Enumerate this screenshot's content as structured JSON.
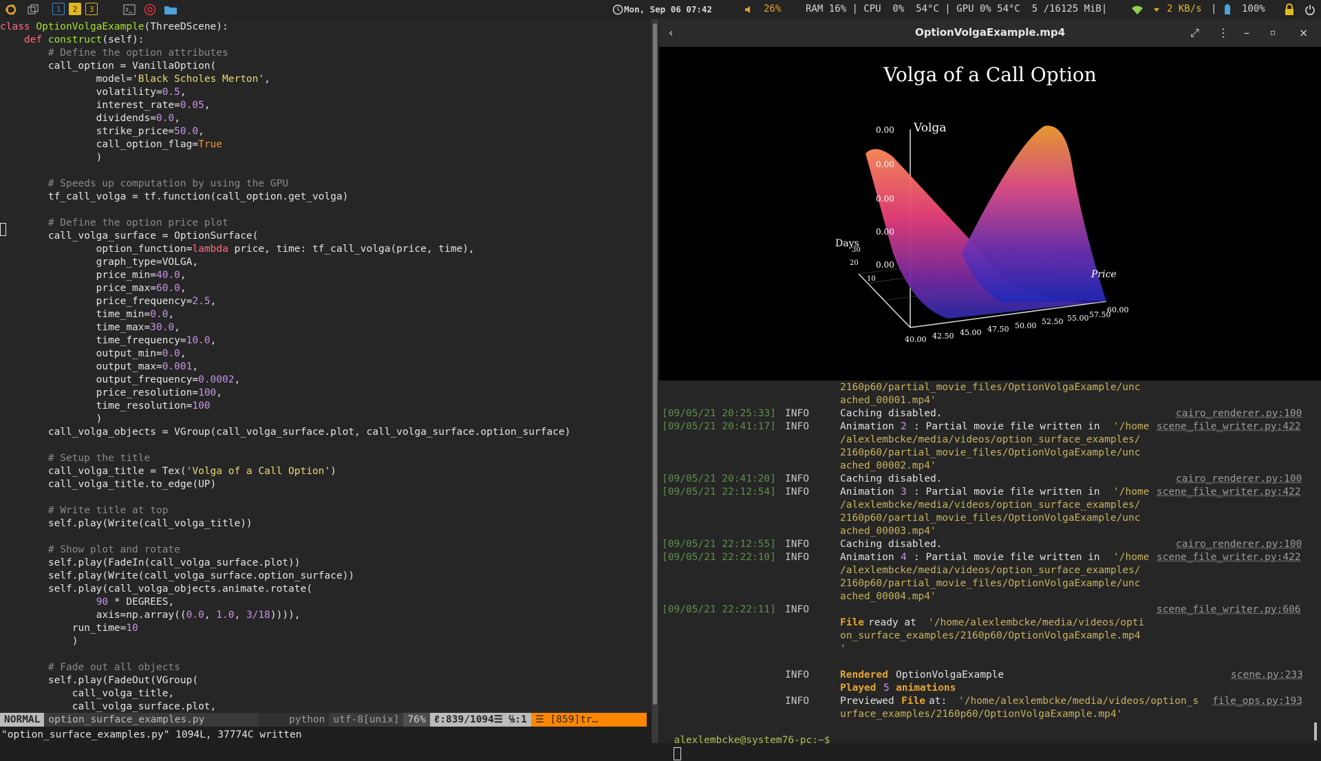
{
  "topbar": {
    "workspaces": [
      "1",
      "2",
      "3"
    ],
    "datetime": "Mon, Sep 06 07:42",
    "volume": "26%",
    "stats": "RAM 16% | CPU  0%  54°C | GPU 0% 54°C  5 /16125 MiB|",
    "net": "2 KB/s",
    "battery": "100%"
  },
  "editor": {
    "lines": [
      [
        [
          "kw",
          "class "
        ],
        [
          "cls",
          "OptionVolgaExample"
        ],
        [
          "fn",
          "(ThreeDScene):"
        ]
      ],
      [
        [
          "fn",
          "    "
        ],
        [
          "kw",
          "def "
        ],
        [
          "cls",
          "construct"
        ],
        [
          "fn",
          "(self):"
        ]
      ],
      [
        [
          "cmt",
          "        # Define the option attributes"
        ]
      ],
      [
        [
          "fn",
          "        call_option = VanillaOption("
        ]
      ],
      [
        [
          "fn",
          "                model="
        ],
        [
          "str",
          "'Black Scholes Merton'"
        ],
        [
          "fn",
          ","
        ]
      ],
      [
        [
          "fn",
          "                volatility="
        ],
        [
          "num",
          "0.5"
        ],
        [
          "fn",
          ","
        ]
      ],
      [
        [
          "fn",
          "                interest_rate="
        ],
        [
          "num",
          "0.05"
        ],
        [
          "fn",
          ","
        ]
      ],
      [
        [
          "fn",
          "                dividends="
        ],
        [
          "num",
          "0.0"
        ],
        [
          "fn",
          ","
        ]
      ],
      [
        [
          "fn",
          "                strike_price="
        ],
        [
          "num",
          "50.0"
        ],
        [
          "fn",
          ","
        ]
      ],
      [
        [
          "fn",
          "                call_option_flag="
        ],
        [
          "bool",
          "True"
        ]
      ],
      [
        [
          "fn",
          "                )"
        ]
      ],
      [
        [
          "fn",
          ""
        ]
      ],
      [
        [
          "cmt",
          "        # Speeds up computation by using the GPU"
        ]
      ],
      [
        [
          "fn",
          "        tf_call_volga = tf.function(call_option.get_volga)"
        ]
      ],
      [
        [
          "fn",
          ""
        ]
      ],
      [
        [
          "cmt",
          "        # Define the option price plot"
        ]
      ],
      [
        [
          "fn",
          "        call_volga_surface = OptionSurface("
        ]
      ],
      [
        [
          "fn",
          "                option_function="
        ],
        [
          "kw",
          "lambda "
        ],
        [
          "fn",
          "price, time: tf_call_volga(price, time),"
        ]
      ],
      [
        [
          "fn",
          "                graph_type=VOLGA,"
        ]
      ],
      [
        [
          "fn",
          "                price_min="
        ],
        [
          "num",
          "40.0"
        ],
        [
          "fn",
          ","
        ]
      ],
      [
        [
          "fn",
          "                price_max="
        ],
        [
          "num",
          "60.0"
        ],
        [
          "fn",
          ","
        ]
      ],
      [
        [
          "fn",
          "                price_frequency="
        ],
        [
          "num",
          "2.5"
        ],
        [
          "fn",
          ","
        ]
      ],
      [
        [
          "fn",
          "                time_min="
        ],
        [
          "num",
          "0.0"
        ],
        [
          "fn",
          ","
        ]
      ],
      [
        [
          "fn",
          "                time_max="
        ],
        [
          "num",
          "30.0"
        ],
        [
          "fn",
          ","
        ]
      ],
      [
        [
          "fn",
          "                time_frequency="
        ],
        [
          "num",
          "10.0"
        ],
        [
          "fn",
          ","
        ]
      ],
      [
        [
          "fn",
          "                output_min="
        ],
        [
          "num",
          "0.0"
        ],
        [
          "fn",
          ","
        ]
      ],
      [
        [
          "fn",
          "                output_max="
        ],
        [
          "num",
          "0.001"
        ],
        [
          "fn",
          ","
        ]
      ],
      [
        [
          "fn",
          "                output_frequency="
        ],
        [
          "num",
          "0.0002"
        ],
        [
          "fn",
          ","
        ]
      ],
      [
        [
          "fn",
          "                price_resolution="
        ],
        [
          "num",
          "100"
        ],
        [
          "fn",
          ","
        ]
      ],
      [
        [
          "fn",
          "                time_resolution="
        ],
        [
          "num",
          "100"
        ]
      ],
      [
        [
          "fn",
          "                )"
        ]
      ],
      [
        [
          "fn",
          "        call_volga_objects = VGroup(call_volga_surface.plot, call_volga_surface.option_surface)"
        ]
      ],
      [
        [
          "fn",
          ""
        ]
      ],
      [
        [
          "cmt",
          "        # Setup the title"
        ]
      ],
      [
        [
          "fn",
          "        call_volga_title = Tex("
        ],
        [
          "str",
          "'Volga of a Call Option'"
        ],
        [
          "fn",
          ")"
        ]
      ],
      [
        [
          "fn",
          "        call_volga_title.to_edge(UP)"
        ]
      ],
      [
        [
          "fn",
          ""
        ]
      ],
      [
        [
          "cmt",
          "        # Write title at top"
        ]
      ],
      [
        [
          "fn",
          "        self.play(Write(call_volga_title))"
        ]
      ],
      [
        [
          "fn",
          ""
        ]
      ],
      [
        [
          "cmt",
          "        # Show plot and rotate"
        ]
      ],
      [
        [
          "fn",
          "        self.play(FadeIn(call_volga_surface.plot))"
        ]
      ],
      [
        [
          "fn",
          "        self.play(Write(call_volga_surface.option_surface))"
        ]
      ],
      [
        [
          "fn",
          "        self.play(call_volga_objects.animate.rotate("
        ]
      ],
      [
        [
          "fn",
          "                "
        ],
        [
          "num",
          "90"
        ],
        [
          "fn",
          " * DEGREES,"
        ]
      ],
      [
        [
          "fn",
          "                axis=np.array(("
        ],
        [
          "num",
          "0.0"
        ],
        [
          "fn",
          ", "
        ],
        [
          "num",
          "1.0"
        ],
        [
          "fn",
          ", "
        ],
        [
          "num",
          "3/18"
        ],
        [
          "fn",
          ")))),"
        ]
      ],
      [
        [
          "fn",
          "            run_time="
        ],
        [
          "num",
          "10"
        ]
      ],
      [
        [
          "fn",
          "            )"
        ]
      ],
      [
        [
          "fn",
          ""
        ]
      ],
      [
        [
          "cmt",
          "        # Fade out all objects"
        ]
      ],
      [
        [
          "fn",
          "        self.play(FadeOut(VGroup("
        ]
      ],
      [
        [
          "fn",
          "            call_volga_title,"
        ]
      ],
      [
        [
          "fn",
          "            call_volga_surface.plot,"
        ]
      ]
    ],
    "status": {
      "mode": "NORMAL",
      "file": "option_surface_examples.py",
      "filetype": "python",
      "encoding": "utf-8[unix]",
      "percent": "76%",
      "position": "ℓ:839/1094☰ ℅:1",
      "warning": "☰ [859]tr…"
    },
    "cmdline": "\"option_surface_examples.py\" 1094L, 37774C written"
  },
  "video": {
    "title": "OptionVolgaExample.mp4",
    "plot_title": "Volga of a Call Option",
    "zlabel": "Volga",
    "xlabel": "Price",
    "ylabel": "Days",
    "z_ticks": [
      "0.00",
      "0.00",
      "0.00",
      "0.00",
      "0.00"
    ],
    "x_ticks": [
      "40.00",
      "42.50",
      "45.00",
      "47.50",
      "50.00",
      "52.50",
      "55.00",
      "57.50",
      "60.00"
    ],
    "y_ticks": [
      "10",
      "20",
      "30"
    ]
  },
  "terminal": {
    "lines": [
      {
        "y": 564,
        "cols": [
          {
            "x": 1221,
            "cls": "path",
            "t": "2160p60/partial_movie_files/OptionVolgaExample/unc"
          }
        ]
      },
      {
        "y": 583,
        "cols": [
          {
            "x": 1221,
            "cls": "path",
            "t": "ached_00001.mp4'"
          }
        ]
      },
      {
        "y": 602,
        "cols": [
          {
            "x": 962,
            "cls": "ts",
            "t": "[09/05/21 20:25:33]"
          },
          {
            "x": 1141,
            "cls": "lvl",
            "t": "INFO"
          },
          {
            "x": 1221,
            "cls": "msg",
            "t": "Caching disabled."
          },
          {
            "x": 1709,
            "cls": "src",
            "t": "cairo_renderer.py:100"
          }
        ]
      },
      {
        "y": 621,
        "cols": [
          {
            "x": 962,
            "cls": "ts",
            "t": "[09/05/21 20:41:17]"
          },
          {
            "x": 1141,
            "cls": "lvl",
            "t": "INFO"
          },
          {
            "x": 1221,
            "cls": "msg",
            "t": "Animation "
          },
          {
            "x": 1309,
            "cls": "num",
            "t": "2"
          },
          {
            "x": 1328,
            "cls": "msg",
            "t": ": Partial movie file written in "
          },
          {
            "x": 1618,
            "cls": "path",
            "t": "'/home"
          },
          {
            "x": 1681,
            "cls": "src",
            "t": "scene_file_writer.py:422"
          }
        ]
      },
      {
        "y": 640,
        "cols": [
          {
            "x": 1221,
            "cls": "path",
            "t": "/alexlembcke/media/videos/option_surface_examples/"
          }
        ]
      },
      {
        "y": 659,
        "cols": [
          {
            "x": 1221,
            "cls": "path",
            "t": "2160p60/partial_movie_files/OptionVolgaExample/unc"
          }
        ]
      },
      {
        "y": 678,
        "cols": [
          {
            "x": 1221,
            "cls": "path",
            "t": "ached_00002.mp4'"
          }
        ]
      },
      {
        "y": 697,
        "cols": [
          {
            "x": 962,
            "cls": "ts",
            "t": "[09/05/21 20:41:20]"
          },
          {
            "x": 1141,
            "cls": "lvl",
            "t": "INFO"
          },
          {
            "x": 1221,
            "cls": "msg",
            "t": "Caching disabled."
          },
          {
            "x": 1709,
            "cls": "src",
            "t": "cairo_renderer.py:100"
          }
        ]
      },
      {
        "y": 716,
        "cols": [
          {
            "x": 962,
            "cls": "ts",
            "t": "[09/05/21 22:12:54]"
          },
          {
            "x": 1141,
            "cls": "lvl",
            "t": "INFO"
          },
          {
            "x": 1221,
            "cls": "msg",
            "t": "Animation "
          },
          {
            "x": 1309,
            "cls": "num",
            "t": "3"
          },
          {
            "x": 1328,
            "cls": "msg",
            "t": ": Partial movie file written in "
          },
          {
            "x": 1618,
            "cls": "path",
            "t": "'/home"
          },
          {
            "x": 1681,
            "cls": "src",
            "t": "scene_file_writer.py:422"
          }
        ]
      },
      {
        "y": 735,
        "cols": [
          {
            "x": 1221,
            "cls": "path",
            "t": "/alexlembcke/media/videos/option_surface_examples/"
          }
        ]
      },
      {
        "y": 754,
        "cols": [
          {
            "x": 1221,
            "cls": "path",
            "t": "2160p60/partial_movie_files/OptionVolgaExample/unc"
          }
        ]
      },
      {
        "y": 773,
        "cols": [
          {
            "x": 1221,
            "cls": "path",
            "t": "ached_00003.mp4'"
          }
        ]
      },
      {
        "y": 792,
        "cols": [
          {
            "x": 962,
            "cls": "ts",
            "t": "[09/05/21 22:12:55]"
          },
          {
            "x": 1141,
            "cls": "lvl",
            "t": "INFO"
          },
          {
            "x": 1221,
            "cls": "msg",
            "t": "Caching disabled."
          },
          {
            "x": 1709,
            "cls": "src",
            "t": "cairo_renderer.py:100"
          }
        ]
      },
      {
        "y": 811,
        "cols": [
          {
            "x": 962,
            "cls": "ts",
            "t": "[09/05/21 22:22:10]"
          },
          {
            "x": 1141,
            "cls": "lvl",
            "t": "INFO"
          },
          {
            "x": 1221,
            "cls": "msg",
            "t": "Animation "
          },
          {
            "x": 1309,
            "cls": "num",
            "t": "4"
          },
          {
            "x": 1328,
            "cls": "msg",
            "t": ": Partial movie file written in "
          },
          {
            "x": 1618,
            "cls": "path",
            "t": "'/home"
          },
          {
            "x": 1681,
            "cls": "src",
            "t": "scene_file_writer.py:422"
          }
        ]
      },
      {
        "y": 830,
        "cols": [
          {
            "x": 1221,
            "cls": "path",
            "t": "/alexlembcke/media/videos/option_surface_examples/"
          }
        ]
      },
      {
        "y": 849,
        "cols": [
          {
            "x": 1221,
            "cls": "path",
            "t": "2160p60/partial_movie_files/OptionVolgaExample/unc"
          }
        ]
      },
      {
        "y": 868,
        "cols": [
          {
            "x": 1221,
            "cls": "path",
            "t": "ached_00004.mp4'"
          }
        ]
      },
      {
        "y": 887,
        "cols": [
          {
            "x": 962,
            "cls": "ts",
            "t": "[09/05/21 22:22:11]"
          },
          {
            "x": 1141,
            "cls": "lvl",
            "t": "INFO"
          },
          {
            "x": 1681,
            "cls": "src",
            "t": "scene_file_writer.py:606"
          }
        ]
      },
      {
        "y": 906,
        "cols": [
          {
            "x": 1221,
            "cls": "msg bold orange",
            "t": "File"
          },
          {
            "x": 1262,
            "cls": "msg",
            "t": "ready at "
          },
          {
            "x": 1349,
            "cls": "path",
            "t": "'/home/alexlembcke/media/videos/opti"
          }
        ]
      },
      {
        "y": 925,
        "cols": [
          {
            "x": 1221,
            "cls": "path",
            "t": "on_surface_examples/2160p60/OptionVolgaExample.mp4"
          }
        ]
      },
      {
        "y": 944,
        "cols": [
          {
            "x": 1221,
            "cls": "path",
            "t": "'"
          }
        ]
      },
      {
        "y": 982,
        "cols": [
          {
            "x": 1141,
            "cls": "lvl",
            "t": "INFO"
          },
          {
            "x": 1221,
            "cls": "msg bold orange",
            "t": "Rendered"
          },
          {
            "x": 1302,
            "cls": "msg",
            "t": "OptionVolgaExample"
          },
          {
            "x": 1789,
            "cls": "src",
            "t": "scene.py:233"
          }
        ]
      },
      {
        "y": 1001,
        "cols": [
          {
            "x": 1221,
            "cls": "msg bold orange",
            "t": "Played"
          },
          {
            "x": 1284,
            "cls": "num",
            "t": "5"
          },
          {
            "x": 1302,
            "cls": "msg bold orange",
            "t": "animations"
          }
        ]
      },
      {
        "y": 1020,
        "cols": [
          {
            "x": 1141,
            "cls": "lvl",
            "t": "INFO"
          },
          {
            "x": 1221,
            "cls": "msg",
            "t": "Previewed "
          },
          {
            "x": 1310,
            "cls": "msg bold orange",
            "t": "File"
          },
          {
            "x": 1350,
            "cls": "msg",
            "t": "at: "
          },
          {
            "x": 1393,
            "cls": "path",
            "t": "'/home/alexlembcke/media/videos/option_s"
          },
          {
            "x": 1762,
            "cls": "src",
            "t": "file_ops.py:193"
          }
        ]
      },
      {
        "y": 1039,
        "cols": [
          {
            "x": 1221,
            "cls": "path",
            "t": "urface_examples/2160p60/OptionVolgaExample.mp4'"
          }
        ]
      }
    ],
    "prompt": "alexlembcke@system76-pc:~$"
  }
}
